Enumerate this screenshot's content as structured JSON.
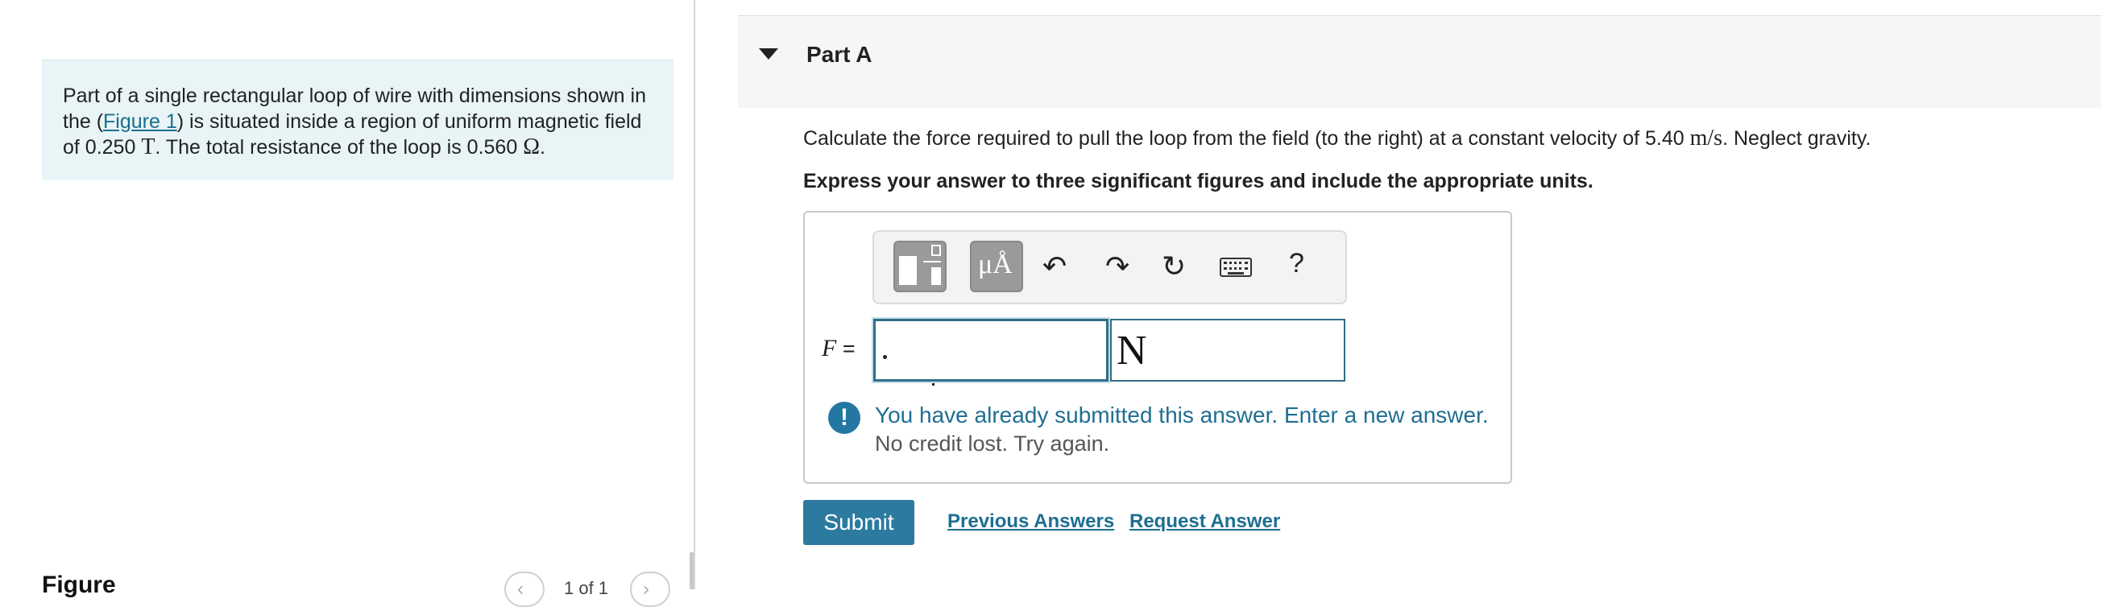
{
  "problem": {
    "text_before_link": "Part of a single rectangular loop of wire with dimensions shown in the (",
    "figure_link": "Figure 1",
    "text_after_link": ") is situated inside a region of uniform magnetic field of 0.250 ",
    "field_unit": "T",
    "text_mid": ". The total resistance of the loop is 0.560 ",
    "resistance_unit": "Ω",
    "text_end": "."
  },
  "figure": {
    "label": "Figure",
    "counter": "1 of 1"
  },
  "part": {
    "title": "Part A"
  },
  "question": {
    "text_before": "Calculate the force required to pull the loop from the field (to the right) at a constant velocity of 5.40 ",
    "velocity_unit": "m/s",
    "text_after": ". Neglect gravity.",
    "instruction": "Express your answer to three significant figures and include the appropriate units."
  },
  "toolbar": {
    "units_glyph": "μÅ",
    "undo_glyph": "↶",
    "redo_glyph": "↷",
    "reset_glyph": "↻",
    "help_glyph": "?"
  },
  "answer": {
    "variable": "F",
    "equals": " =",
    "value": "",
    "unit": "N"
  },
  "feedback": {
    "icon": "!",
    "line1": "You have already submitted this answer. Enter a new answer.",
    "line2": "No credit lost. Try again."
  },
  "actions": {
    "submit": "Submit",
    "previous_answers": "Previous Answers",
    "request_answer": "Request Answer"
  },
  "colors": {
    "accent": "#2c7aa0",
    "problem_bg": "#e8f4f5",
    "alert": "#2477a3"
  }
}
